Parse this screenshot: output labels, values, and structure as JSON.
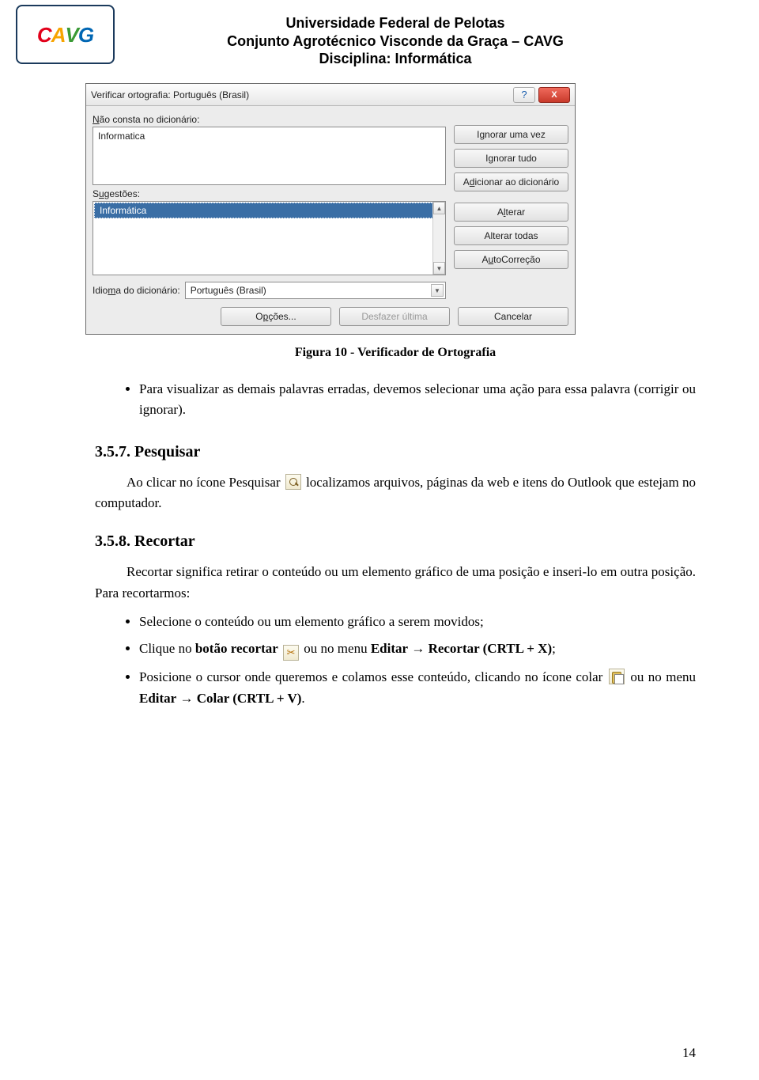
{
  "header": {
    "logo_letters": {
      "c": "C",
      "a": "A",
      "v": "V",
      "g": "G"
    },
    "line1": "Universidade Federal de Pelotas",
    "line2": "Conjunto Agrotécnico Visconde da Graça – CAVG",
    "line3": "Disciplina: Informática"
  },
  "dialog": {
    "title": "Verificar ortografia: Português (Brasil)",
    "help_symbol": "?",
    "close_symbol": "X",
    "not_in_dict_label_pre": "N",
    "not_in_dict_label_post": "ão consta no dicionário:",
    "not_in_dict_value": "Informatica",
    "suggestions_label_pre": "S",
    "suggestions_label_mid": "u",
    "suggestions_label_post": "gestões:",
    "suggestion_selected": "Informática",
    "lang_label_pre": "Idio",
    "lang_label_mid": "m",
    "lang_label_post": "a do dicionário:",
    "lang_value": "Português (Brasil)",
    "buttons": {
      "ignore_once_pre": "I",
      "ignore_once_mid": "g",
      "ignore_once_post": "norar uma vez",
      "ignore_all": "Ignorar tudo",
      "add_dict_pre": "A",
      "add_dict_mid": "d",
      "add_dict_post": "icionar ao dicionário",
      "change_pre": "A",
      "change_mid": "l",
      "change_post": "terar",
      "change_all": "Alterar todas",
      "autocorrect_pre": "A",
      "autocorrect_mid": "u",
      "autocorrect_post": "toCorreção",
      "options_pre": "O",
      "options_mid": "p",
      "options_post": "ções...",
      "undo": "Desfazer última",
      "cancel": "Cancelar"
    }
  },
  "caption": "Figura 10 - Verificador de Ortografia",
  "bullet1": "Para visualizar as demais palavras erradas, devemos selecionar uma ação para essa palavra (corrigir ou ignorar).",
  "sec357_num": "3.5.7.",
  "sec357_title": "Pesquisar",
  "para357a": "Ao clicar no ícone Pesquisar",
  "para357b": "localizamos arquivos, páginas da web e itens do Outlook que estejam no computador.",
  "sec358_num": "3.5.8.",
  "sec358_title": "Recortar",
  "para358": "Recortar significa retirar o conteúdo ou um elemento gráfico de uma posição e inseri-lo em outra posição. Para recortarmos:",
  "bullet2": "Selecione o conteúdo ou um elemento gráfico a serem movidos;",
  "bullet3_a": "Clique no ",
  "bullet3_b": "botão recortar",
  "bullet3_c": "ou no menu ",
  "bullet3_d": "Editar",
  "bullet3_e": "Recortar (CRTL + X)",
  "bullet3_f": ";",
  "bullet4_a": "Posicione o cursor onde queremos e colamos esse conteúdo, clicando no ícone colar",
  "bullet4_b": "ou no menu ",
  "bullet4_c": "Editar",
  "bullet4_d": "Colar (CRTL + V)",
  "bullet4_e": ".",
  "page_number": "14",
  "arrow": "→"
}
